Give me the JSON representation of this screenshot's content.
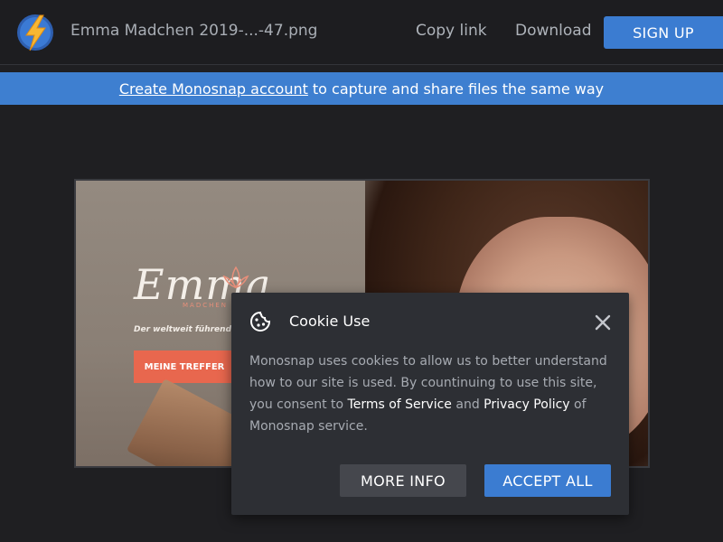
{
  "header": {
    "logo_icon": "lightning-bolt-icon",
    "filename": "Emma Madchen 2019-...-47.png",
    "copy_link_label": "Copy link",
    "download_label": "Download",
    "signup_label": "SIGN UP"
  },
  "banner": {
    "link_text": "Create Monosnap account",
    "rest_text": "to capture and share files the same way"
  },
  "preview": {
    "brand": "Emma",
    "brand_sub": "MADCHEN",
    "tagline": "Der weltweit führende D",
    "cta": "MEINE TREFFER"
  },
  "cookie": {
    "icon": "cookie-icon",
    "title": "Cookie Use",
    "close_icon": "close-icon",
    "text_part1": "Monosnap uses cookies to allow us to better understand how to our site is used. By countinuing to use this site, you consent to",
    "terms_link": "Terms of Service",
    "and_text": "and",
    "privacy_link": "Privacy Policy",
    "text_part2": "of Monosnap service.",
    "more_info_label": "MORE INFO",
    "accept_all_label": "ACCEPT ALL"
  },
  "colors": {
    "accent_blue": "#3b7cd1",
    "background": "#1f1f22",
    "dialog": "#2d2f34",
    "cta_coral": "#e8674e"
  }
}
